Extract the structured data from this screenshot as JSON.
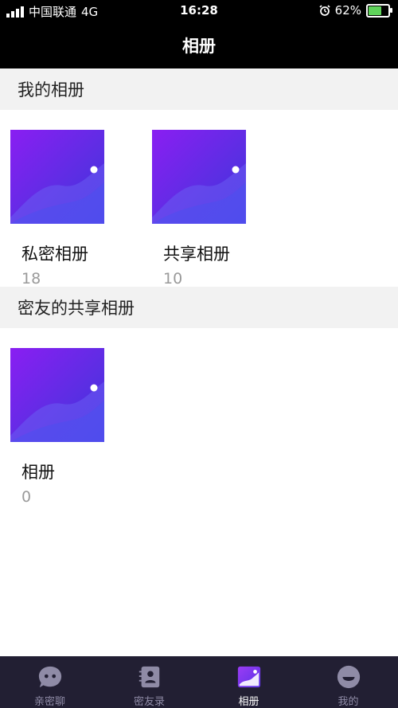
{
  "status_bar": {
    "carrier": "中国联通",
    "network": "4G",
    "time": "16:28",
    "battery": "62%",
    "battery_level": 0.62
  },
  "header": {
    "title": "相册"
  },
  "my_albums": {
    "title": "我的相册",
    "items": [
      {
        "name": "私密相册",
        "count": "18"
      },
      {
        "name": "共享相册",
        "count": "10"
      }
    ]
  },
  "shared_albums": {
    "title": "密友的共享相册",
    "items": [
      {
        "name": "相册",
        "count": "0"
      }
    ]
  },
  "tab_bar": {
    "items": [
      {
        "label": "亲密聊",
        "icon": "chat-face-icon"
      },
      {
        "label": "密友录",
        "icon": "contact-book-icon"
      },
      {
        "label": "相册",
        "icon": "album-icon",
        "active": true
      },
      {
        "label": "我的",
        "icon": "profile-face-icon"
      }
    ]
  },
  "colors": {
    "accent": "#7b2ff0",
    "tab_bar_bg": "#221f33",
    "header_bg": "#000000"
  }
}
